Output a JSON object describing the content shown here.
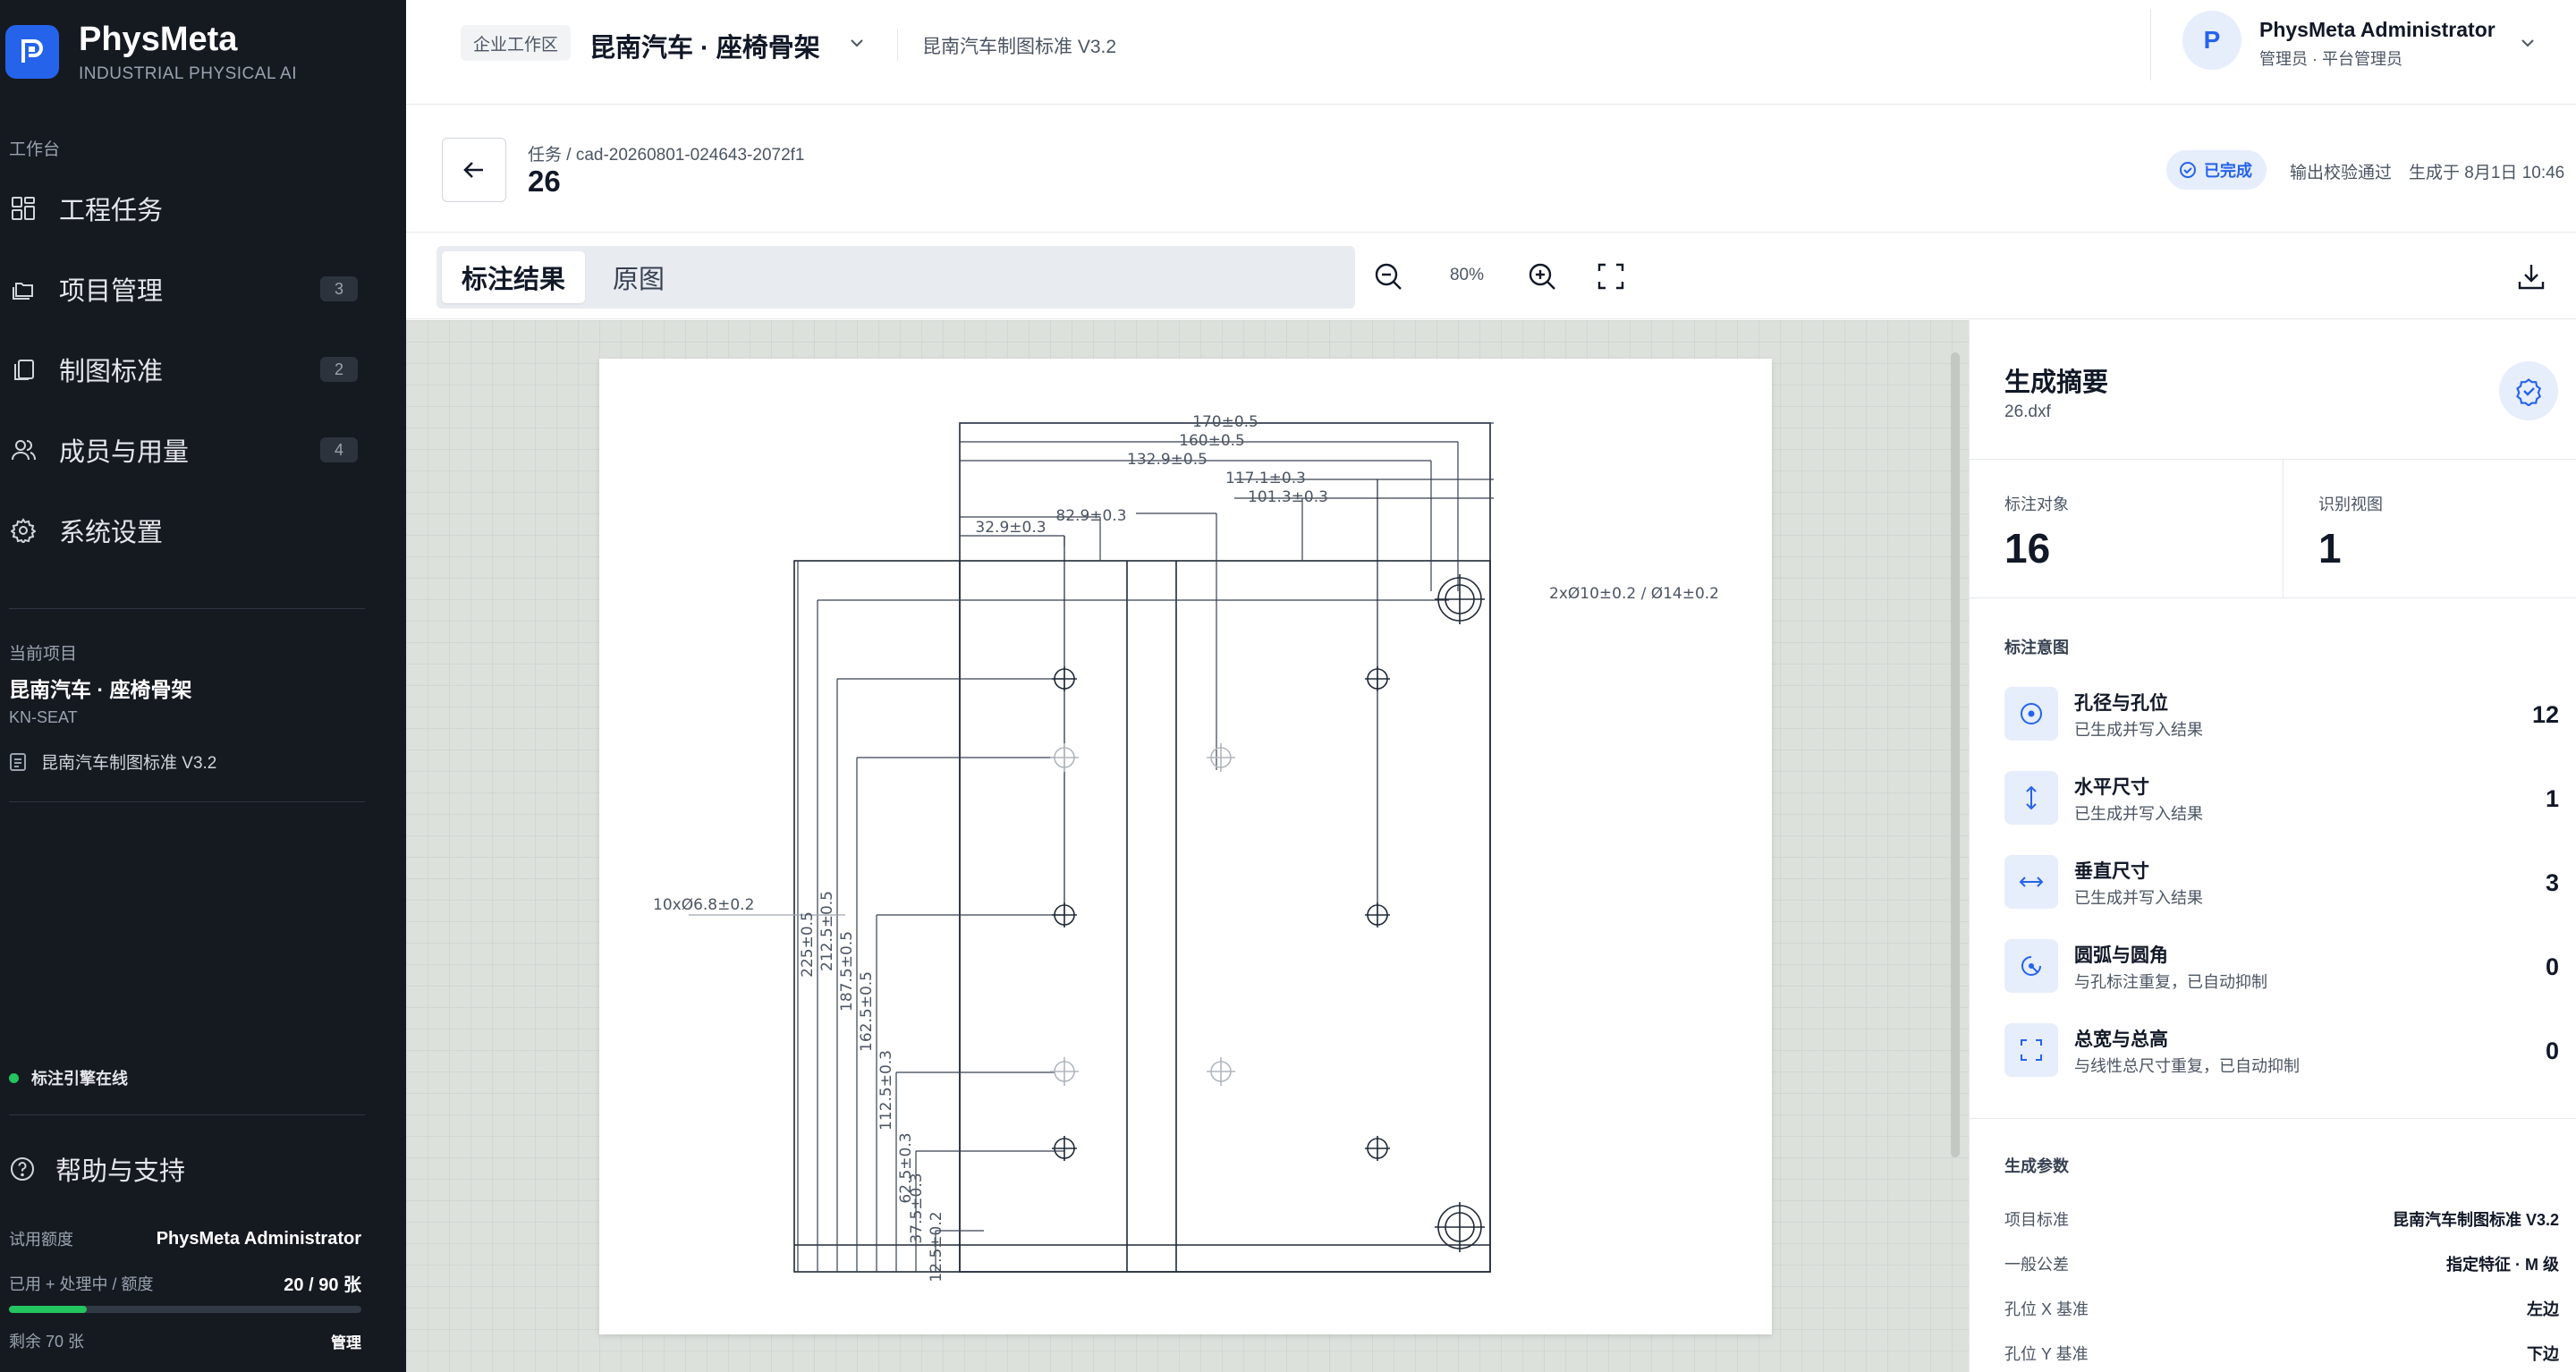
{
  "brand": {
    "name": "PhysMeta",
    "tagline": "INDUSTRIAL PHYSICAL AI"
  },
  "sidebar": {
    "section_label": "工作台",
    "items": [
      {
        "label": "工程任务",
        "icon": "grid-icon",
        "badge": ""
      },
      {
        "label": "项目管理",
        "icon": "folders-icon",
        "badge": "3"
      },
      {
        "label": "制图标准",
        "icon": "copy-icon",
        "badge": "2"
      },
      {
        "label": "成员与用量",
        "icon": "users-icon",
        "badge": "4"
      },
      {
        "label": "系统设置",
        "icon": "gear-icon",
        "badge": ""
      }
    ],
    "current_project": {
      "label": "当前项目",
      "name": "昆南汽车 · 座椅骨架",
      "code": "KN-SEAT",
      "standard": "昆南汽车制图标准 V3.2"
    },
    "engine_status": "标注引擎在线",
    "help_label": "帮助与支持",
    "quota": {
      "plan_label": "试用额度",
      "owner": "PhysMeta Administrator",
      "usage_label": "已用 + 处理中 / 额度",
      "usage_value": "20 / 90 张",
      "used_fraction": 0.222,
      "remaining": "剩余 70 张",
      "manage_label": "管理"
    }
  },
  "topbar": {
    "workspace_badge": "企业工作区",
    "workspace_title": "昆南汽车 · 座椅骨架",
    "standard": "昆南汽车制图标准 V3.2",
    "user": {
      "initial": "P",
      "name": "PhysMeta Administrator",
      "role": "管理员 · 平台管理员"
    }
  },
  "task": {
    "breadcrumb": "任务 / cad-20260801-024643-2072f1",
    "title": "26",
    "status": "已完成",
    "verify": "输出校验通过",
    "generated": "生成于 8月1日 10:46"
  },
  "toolbar": {
    "tab_result": "标注结果",
    "tab_original": "原图",
    "zoom": "80%"
  },
  "drawing": {
    "dims_top": [
      "170±0.5",
      "160±0.5",
      "132.9±0.5",
      "117.1±0.3",
      "101.3±0.3",
      "82.9±0.3",
      "32.9±0.3"
    ],
    "dims_left": [
      "225±0.5",
      "212.5±0.5",
      "187.5±0.5",
      "162.5±0.5",
      "112.5±0.3",
      "62.5±0.3",
      "37.5±0.3",
      "12.5±0.2"
    ],
    "callout_large_holes": "2xØ10±0.2 / Ø14±0.2",
    "callout_small_holes": "10xØ6.8±0.2"
  },
  "panel": {
    "title": "生成摘要",
    "file": "26.dxf",
    "stats": [
      {
        "label": "标注对象",
        "value": "16"
      },
      {
        "label": "识别视图",
        "value": "1"
      }
    ],
    "intent_heading": "标注意图",
    "intents": [
      {
        "name": "孔径与孔位",
        "desc": "已生成并写入结果",
        "count": "12",
        "icon": "target-icon"
      },
      {
        "name": "水平尺寸",
        "desc": "已生成并写入结果",
        "count": "1",
        "icon": "vertical-arrows-icon"
      },
      {
        "name": "垂直尺寸",
        "desc": "已生成并写入结果",
        "count": "3",
        "icon": "horizontal-arrows-icon"
      },
      {
        "name": "圆弧与圆角",
        "desc": "与孔标注重复，已自动抑制",
        "count": "0",
        "icon": "arc-icon"
      },
      {
        "name": "总宽与总高",
        "desc": "与线性总尺寸重复，已自动抑制",
        "count": "0",
        "icon": "frame-icon"
      }
    ],
    "params_heading": "生成参数",
    "params": [
      {
        "key": "项目标准",
        "value": "昆南汽车制图标准 V3.2"
      },
      {
        "key": "一般公差",
        "value": "指定特征 · M 级"
      },
      {
        "key": "孔位 X 基准",
        "value": "左边"
      },
      {
        "key": "孔位 Y 基准",
        "value": "下边"
      }
    ]
  },
  "colors": {
    "accent": "#2563eb",
    "sidebar_bg": "#151a21",
    "success": "#22c55e",
    "canvas_bg": "#dde1dc"
  }
}
